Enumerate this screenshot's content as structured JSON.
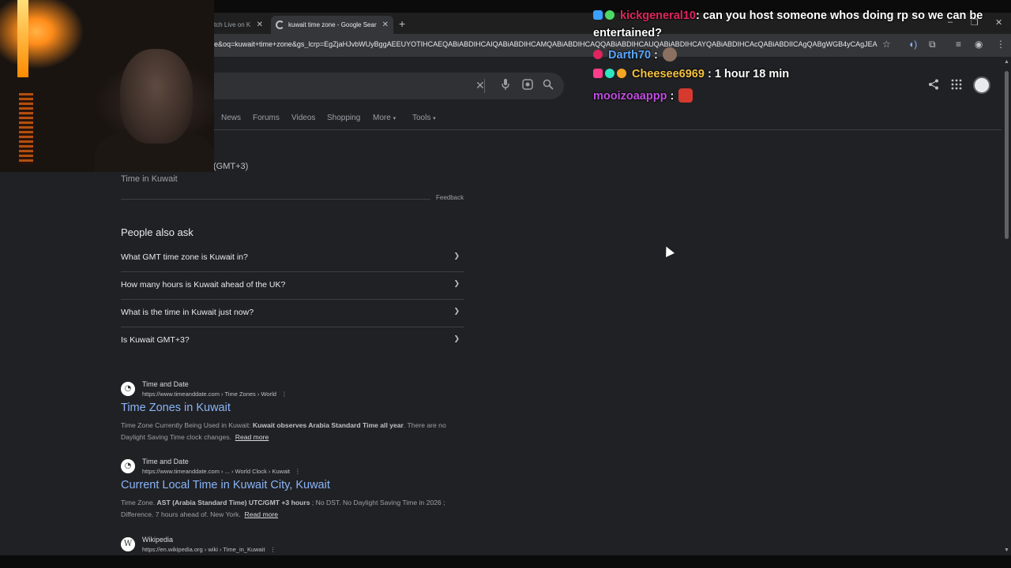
{
  "browser": {
    "tabs": [
      {
        "title": "tch Live on K",
        "active": false
      },
      {
        "title": "kuwait time zone - Google Sear",
        "active": true
      }
    ],
    "new_tab": "+",
    "url": "e&oq=kuwait+time+zone&gs_lcrp=EgZjaHJvbWUyBggAEEUYOTIHCAEQABiABDIHCAIQABiABDIHCAMQABiABDIHCAQQABiABDIHCAUQABiABDIHCAYQABiABDIHCAcQABiABDIICAgQABgWGB4yCAgJEA...",
    "minimize": "‒",
    "restore": "❐",
    "close": "✕"
  },
  "search": {
    "clear_icon": "✕",
    "mic_icon": "🎤",
    "lens_icon": "⌾",
    "search_icon": "⌕"
  },
  "nav_tabs": [
    "News",
    "Forums",
    "Videos",
    "Shopping",
    "More",
    "Tools"
  ],
  "answer": {
    "timezone_partial": "(GMT+3)",
    "subtitle": "Time in Kuwait",
    "feedback": "Feedback"
  },
  "people_also_ask": {
    "title": "People also ask",
    "questions": [
      "What GMT time zone is Kuwait in?",
      "How many hours is Kuwait ahead of the UK?",
      "What is the time in Kuwait just now?",
      "Is Kuwait GMT+3?"
    ]
  },
  "results": [
    {
      "site": "Time and Date",
      "url": "https://www.timeanddate.com › Time Zones › World",
      "title": "Time Zones in Kuwait",
      "snippet_pre": "Time Zone Currently Being Used in Kuwait: ",
      "snippet_bold": "Kuwait observes Arabia Standard Time all year",
      "snippet_post": ". There are no Daylight Saving Time clock changes.",
      "read_more": "Read more",
      "favicon": "◔"
    },
    {
      "site": "Time and Date",
      "url": "https://www.timeanddate.com › ... › World Clock › Kuwait",
      "title": "Current Local Time in Kuwait City, Kuwait",
      "snippet_pre": "Time Zone. ",
      "snippet_bold": "AST (Arabia Standard Time) UTC/GMT +3 hours",
      "snippet_post": " ; No DST. No Daylight Saving Time in 2026 ; Difference. 7 hours ahead of. New York.",
      "read_more": "Read more",
      "favicon": "◔"
    },
    {
      "site": "Wikipedia",
      "url": "https://en.wikipedia.org › wiki › Time_in_Kuwait",
      "title": "",
      "favicon": "W"
    }
  ],
  "chat": {
    "messages": [
      {
        "user": "kickgeneral10",
        "color": "#e0245e",
        "text": ": can you host someone whos doing rp so we can be",
        "line2": "entertained?"
      },
      {
        "user": "Darth70",
        "color": "#5ba8ff",
        "text": " : "
      },
      {
        "user": "Cheesee6969",
        "color": "#f5c242",
        "text": " : 1 hour 18 min"
      },
      {
        "user": "mooizoaappp",
        "color": "#c04de0",
        "text": " : "
      }
    ]
  }
}
